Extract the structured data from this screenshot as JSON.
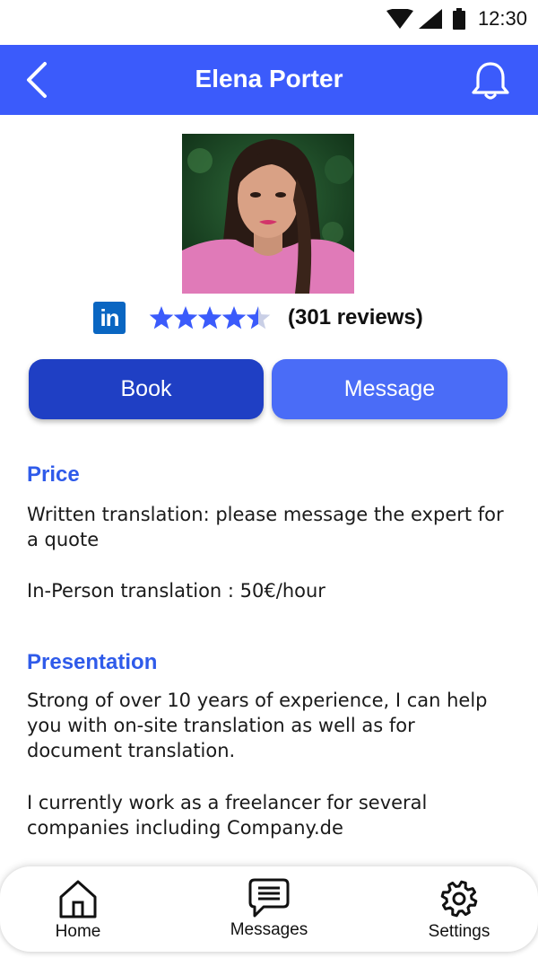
{
  "status_bar": {
    "time": "12:30"
  },
  "header": {
    "title": "Elena Porter"
  },
  "profile": {
    "rating": 4.5,
    "rating_max": 5,
    "reviews_label": "(301 reviews)",
    "linkedin_label": "in"
  },
  "actions": {
    "book_label": "Book",
    "message_label": "Message"
  },
  "price": {
    "title": "Price",
    "written": "Written translation: please message the expert for a quote",
    "in_person": "In-Person translation : 50€/hour"
  },
  "presentation": {
    "title": "Presentation",
    "paragraph1": "Strong of over 10 years of experience, I can help you with on-site translation as well as for document translation.",
    "paragraph2": "I currently work as a freelancer for several companies including Company.de"
  },
  "nav": {
    "home": "Home",
    "messages": "Messages",
    "settings": "Settings"
  },
  "colors": {
    "primary": "#3b5bfb",
    "book_button": "#1f3fc4",
    "message_button": "#4a6cf7",
    "section_title": "#2f5bea",
    "linkedin": "#0a66c2"
  },
  "icons": {
    "back": "chevron-left-icon",
    "notifications": "bell-icon",
    "home": "home-icon",
    "messages": "chat-bubble-icon",
    "settings": "gear-icon"
  }
}
